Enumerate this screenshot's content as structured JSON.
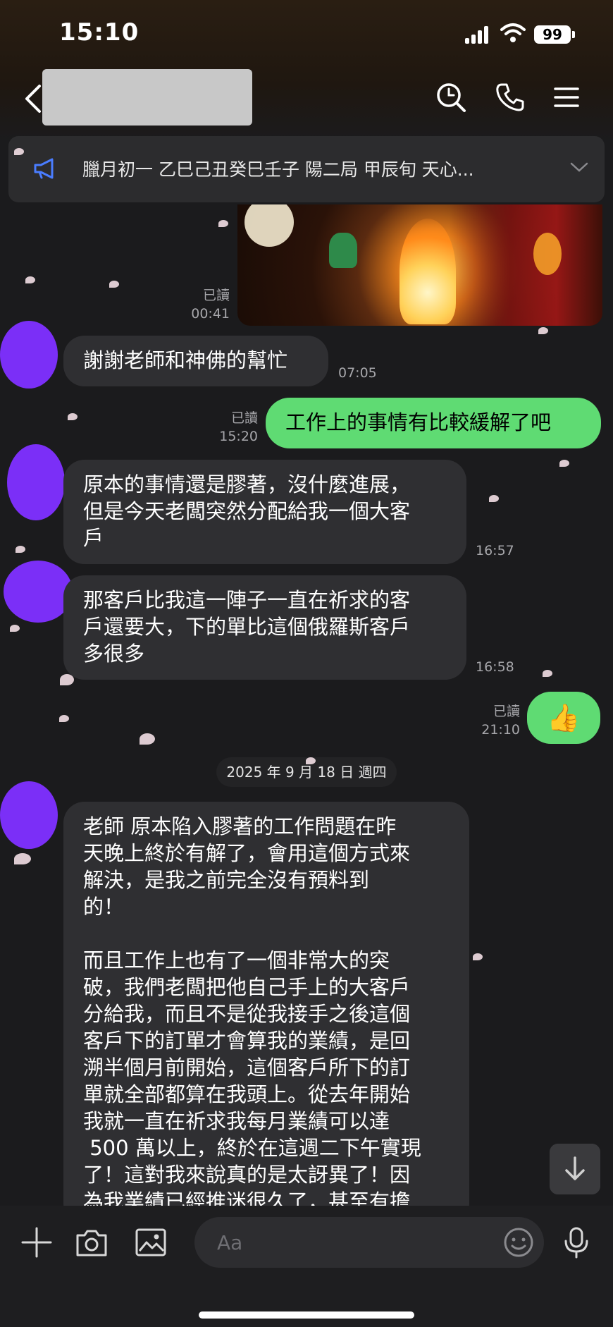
{
  "status_bar": {
    "time": "15:10",
    "battery": "99"
  },
  "announcement": {
    "text": "臘月初一 乙巳己丑癸巳壬子 陽二局 甲辰旬 天心..."
  },
  "messages": [
    {
      "meta_read": "已讀",
      "meta_time": "00:41"
    },
    {
      "text": "謝謝老師和神佛的幫忙",
      "time": "07:05"
    },
    {
      "text": "工作上的事情有比較緩解了吧",
      "read": "已讀",
      "time": "15:20"
    },
    {
      "text": "原本的事情還是膠著，沒什麼進展，\n但是今天老闆突然分配給我一個大客\n戶",
      "time": "16:57"
    },
    {
      "text": "那客戶比我這一陣子一直在祈求的客\n戶還要大，下的單比這個俄羅斯客戶\n多很多",
      "time": "16:58"
    },
    {
      "text": "👍",
      "read": "已讀",
      "time": "21:10"
    },
    {
      "text": "老師 原本陷入膠著的工作問題在昨\n天晚上終於有解了，會用這個方式來\n解決，是我之前完全沒有預料到\n的！\n\n而且工作上也有了一個非常大的突\n破，我們老闆把他自己手上的大客戶\n分給我，而且不是從我接手之後這個\n客戶下的訂單才會算我的業績，是回\n溯半個月前開始，這個客戶所下的訂\n單就全部都算在我頭上。從去年開始\n我就一直在祈求我每月業績可以達\n 500 萬以上，終於在這週二下午實現\n了！這對我來說真的是太訝異了！因\n為我業績已經推迷很久了，甚至有擔"
    }
  ],
  "date_separator": "2025 年 9 月 18 日 週四",
  "input": {
    "placeholder": "Aa"
  },
  "colors": {
    "accent_green": "#5fdb73",
    "avatar_purple": "#7b2ff7",
    "incoming_bubble": "#2f2f32"
  }
}
